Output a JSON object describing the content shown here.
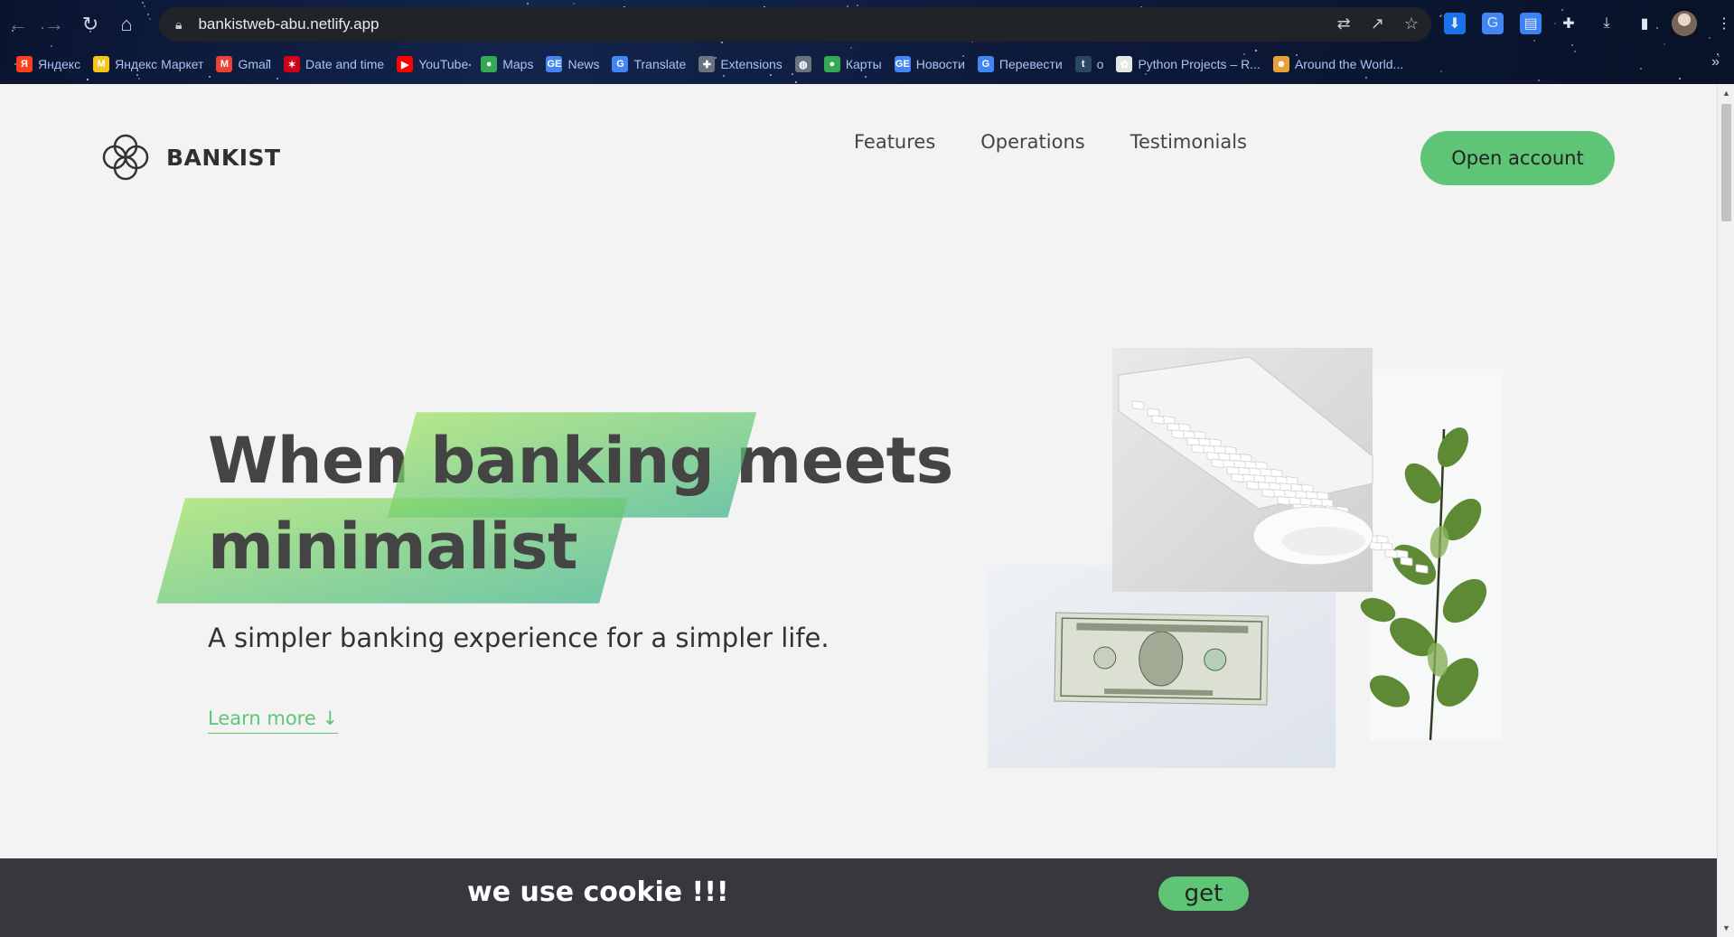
{
  "browser": {
    "url": "bankistweb-abu.netlify.app",
    "bookmarks": [
      {
        "label": "Яндекс",
        "icon": "yandex-icon",
        "color": "#fc3f1d",
        "glyph": "Я"
      },
      {
        "label": "Яндекс Маркет",
        "icon": "yandex-market-icon",
        "color": "#f5c518",
        "glyph": "M"
      },
      {
        "label": "Gmail",
        "icon": "gmail-icon",
        "color": "#ea4335",
        "glyph": "M"
      },
      {
        "label": "Date and time",
        "icon": "date-time-icon",
        "color": "#d0021b",
        "glyph": "✶"
      },
      {
        "label": "YouTube",
        "icon": "youtube-icon",
        "color": "#ff0000",
        "glyph": "▶"
      },
      {
        "label": "Maps",
        "icon": "maps-icon",
        "color": "#34a853",
        "glyph": "●"
      },
      {
        "label": "News",
        "icon": "news-icon",
        "color": "#4285f4",
        "glyph": "GE"
      },
      {
        "label": "Translate",
        "icon": "translate-icon",
        "color": "#4285f4",
        "glyph": "G"
      },
      {
        "label": "Extensions",
        "icon": "extensions-icon",
        "color": "#6b7280",
        "glyph": "✚"
      },
      {
        "label": "",
        "icon": "globe-icon",
        "color": "#6b7280",
        "glyph": "◍"
      },
      {
        "label": "Карты",
        "icon": "maps-ru-icon",
        "color": "#34a853",
        "glyph": "●"
      },
      {
        "label": "Новости",
        "icon": "news-ru-icon",
        "color": "#4285f4",
        "glyph": "GE"
      },
      {
        "label": "Перевести",
        "icon": "translate-ru-icon",
        "color": "#4285f4",
        "glyph": "G"
      },
      {
        "label": "o",
        "icon": "tumblr-icon",
        "color": "#2c4762",
        "glyph": "t"
      },
      {
        "label": "Python Projects – R...",
        "icon": "python-icon",
        "color": "#e6e6e6",
        "glyph": "✿"
      },
      {
        "label": "Around the World...",
        "icon": "around-world-icon",
        "color": "#e8a13a",
        "glyph": "☻"
      }
    ]
  },
  "site": {
    "logo_text": "BANKIST",
    "nav": [
      "Features",
      "Operations",
      "Testimonials"
    ],
    "cta": "Open account"
  },
  "hero": {
    "title_1": "When",
    "title_hl_1": "banking",
    "title_2": "meets",
    "title_hl_2": "minimalist",
    "subtitle": "A simpler banking experience for a simpler life.",
    "learn_more": "Learn more ↓"
  },
  "cookie": {
    "text": "we use cookie !!!",
    "button": "get"
  },
  "colors": {
    "accent": "#5ec576",
    "banner_bg": "#37383d"
  }
}
